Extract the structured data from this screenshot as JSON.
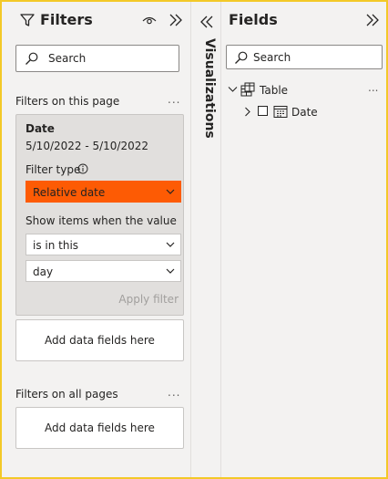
{
  "filters": {
    "title": "Filters",
    "search_placeholder": "Search",
    "page_section": "Filters on this page",
    "all_section": "Filters on all pages",
    "more": "...",
    "card": {
      "field": "Date",
      "range": "5/10/2022 - 5/10/2022",
      "filter_type_label": "Filter type",
      "filter_type_value": "Relative date",
      "show_items_label": "Show items when the value",
      "condition_value": "is in this",
      "unit_value": "day",
      "apply_label": "Apply filter"
    },
    "add_data_label": "Add data fields here"
  },
  "visualizations": {
    "label": "Visualizations"
  },
  "fields": {
    "title": "Fields",
    "search_placeholder": "Search",
    "more": "...",
    "tree": {
      "table_label": "Table",
      "date_label": "Date"
    }
  },
  "colors": {
    "border_frame": "#f3c928",
    "highlight": "#fd5b04",
    "pane_bg": "#f3f2f1"
  }
}
